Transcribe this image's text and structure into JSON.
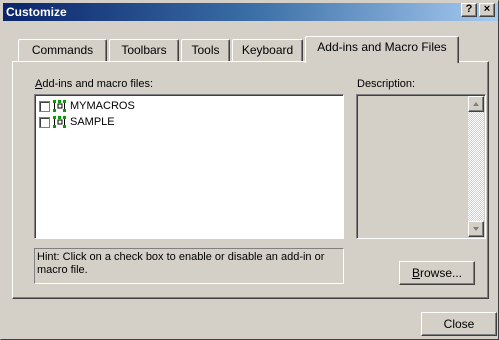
{
  "window": {
    "title": "Customize",
    "help_glyph": "?",
    "close_glyph": "×"
  },
  "tabs": [
    {
      "label": "Commands",
      "active": false
    },
    {
      "label": "Toolbars",
      "active": false
    },
    {
      "label": "Tools",
      "active": false
    },
    {
      "label": "Keyboard",
      "active": false
    },
    {
      "label": "Add-ins and Macro Files",
      "active": true
    }
  ],
  "addins": {
    "label_prefix": "A",
    "label_rest": "dd-ins and macro files:",
    "items": [
      {
        "name": "MYMACROS",
        "checked": false,
        "icon": "addin-icon"
      },
      {
        "name": "SAMPLE",
        "checked": false,
        "icon": "addin-icon"
      }
    ]
  },
  "description": {
    "label": "Description:"
  },
  "hint": "Hint: Click on a check box to enable or disable an add-in or macro file.",
  "buttons": {
    "browse_prefix": "B",
    "browse_rest": "rowse...",
    "close": "Close"
  },
  "colors": {
    "title_start": "#0a246a",
    "title_end": "#a6caf0",
    "face": "#d4d0c8",
    "icon_green": "#00a000"
  }
}
